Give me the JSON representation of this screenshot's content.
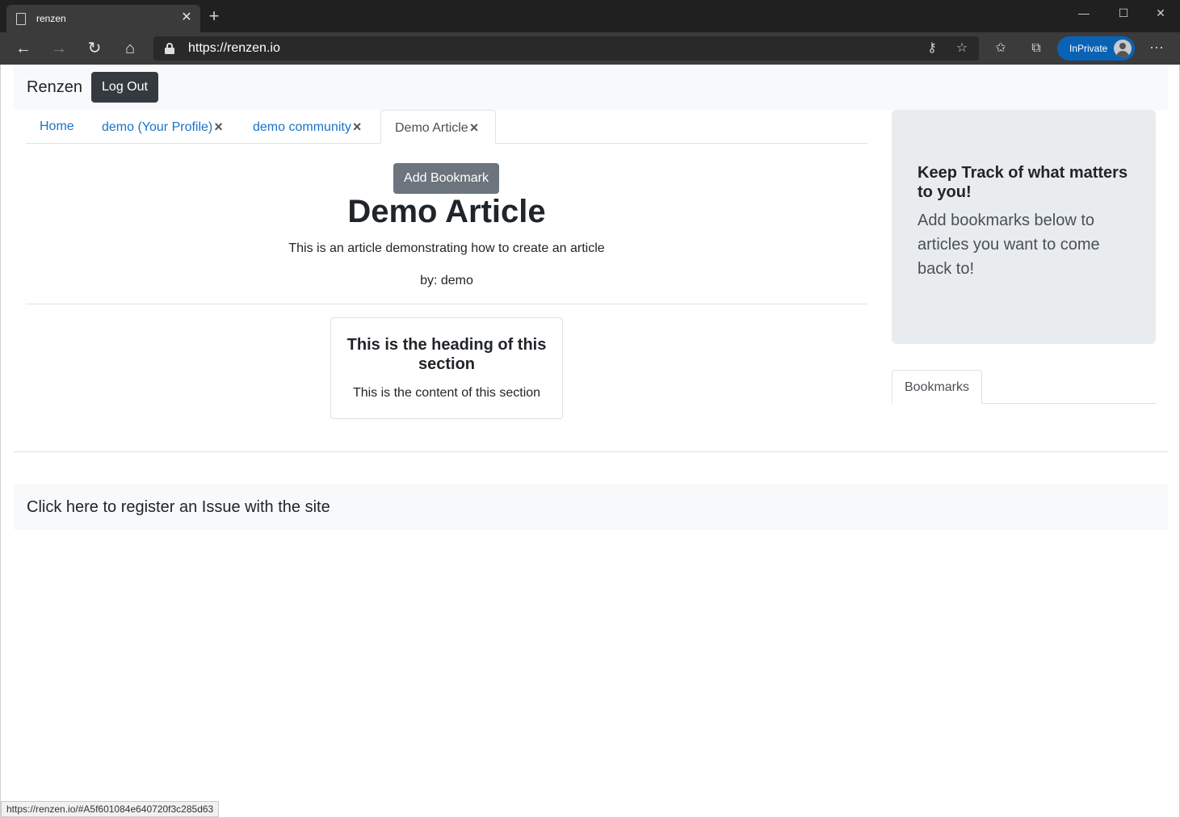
{
  "browser": {
    "tab_title": "renzen",
    "tab_close": "✕",
    "new_tab": "+",
    "url": "https://renzen.io",
    "inprivate_label": "InPrivate",
    "more": "···",
    "status_url": "https://renzen.io/#A5f601084e640720f3c285d63"
  },
  "navbar": {
    "brand": "Renzen",
    "logout_label": "Log Out"
  },
  "tabs": [
    {
      "label": "Home",
      "closable": false
    },
    {
      "label": "demo (Your Profile)",
      "closable": true
    },
    {
      "label": "demo community",
      "closable": true
    },
    {
      "label": "Demo Article",
      "closable": true,
      "active": true
    }
  ],
  "tab_close_glyph": "×",
  "article": {
    "add_bookmark_label": "Add Bookmark",
    "title": "Demo Article",
    "description": "This is an article demonstrating how to create an article",
    "author": "by: demo",
    "section": {
      "heading": "This is the heading of this section",
      "content": "This is the content of this section"
    }
  },
  "sidebar": {
    "heading": "Keep Track of what matters to you!",
    "text": "Add bookmarks below to articles you want to come back to!",
    "tab_label": "Bookmarks"
  },
  "footer": {
    "issue_link": "Click here to register an Issue with the site"
  },
  "colors": {
    "chrome_dark": "#202020",
    "toolbar": "#3b3b3b",
    "inprivate": "#0a62b5",
    "link": "#1a73c9",
    "logout_button": "#343a40",
    "bookmark_button": "#6c757d",
    "jumbotron": "#e9ecef"
  }
}
